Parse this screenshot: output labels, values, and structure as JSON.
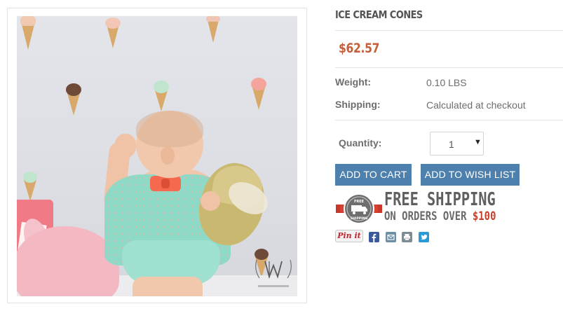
{
  "product": {
    "title": "ICE CREAM CONES",
    "price": "$62.57",
    "image_alt": "Baby in mint romper in front of ice cream cone wall decals",
    "watermark_label": "URBAN WALLS"
  },
  "specs": {
    "weight_label": "Weight:",
    "weight_value": "0.10 LBS",
    "shipping_label": "Shipping:",
    "shipping_value": "Calculated at checkout"
  },
  "quantity": {
    "label": "Quantity:",
    "value": "1",
    "arrow": "▼"
  },
  "buttons": {
    "add_to_cart": "ADD TO CART",
    "add_to_wish_list": "ADD TO WISH LIST"
  },
  "shipping_banner": {
    "badge_text_top": "FREE",
    "badge_text_bottom": "SHIPPING",
    "headline": "FREE SHIPPING",
    "subline_prefix": "ON ORDERS OVER ",
    "subline_amount": "$100"
  },
  "social": {
    "pin_label": "Pin it",
    "icons": [
      "facebook-icon",
      "email-icon",
      "print-icon",
      "twitter-icon"
    ]
  },
  "colors": {
    "price": "#c4603a",
    "button": "#4d80ad",
    "shipping_amount": "#c6402e",
    "facebook": "#3b5a9a",
    "twitter": "#2c9ad7"
  }
}
